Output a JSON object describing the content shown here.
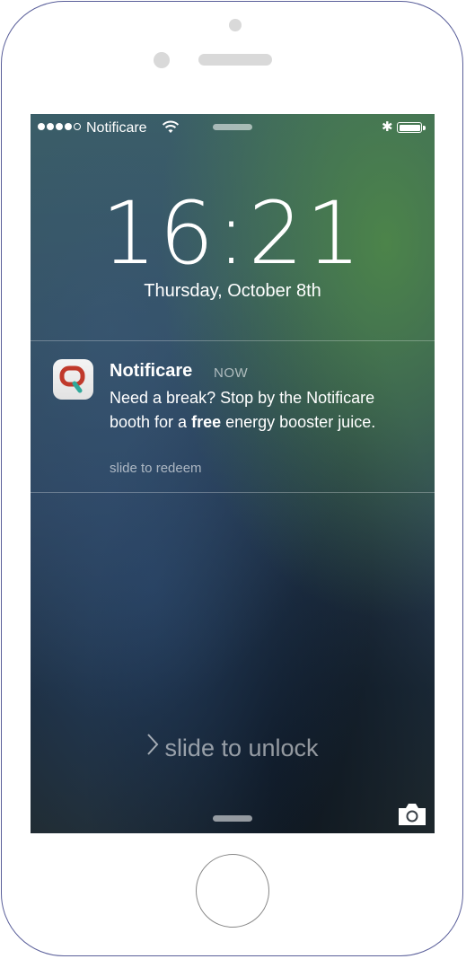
{
  "status_bar": {
    "carrier": "Notificare",
    "signal_bars": 4,
    "signal_total": 5
  },
  "lock_screen": {
    "time": "16:21",
    "date": "Thursday, October 8th"
  },
  "notification": {
    "app_name": "Notificare",
    "time_label": "NOW",
    "message_before": "Need a break? Stop by the Notificare booth for a ",
    "message_bold": "free",
    "message_after": " energy booster juice.",
    "action": "slide to redeem",
    "icon": "notificare-app-icon"
  },
  "unlock": {
    "label": "slide to unlock",
    "chevron_icon": "chevron-right-icon"
  },
  "colors": {
    "icon_red": "#c0392b",
    "icon_teal": "#2fa89a"
  }
}
